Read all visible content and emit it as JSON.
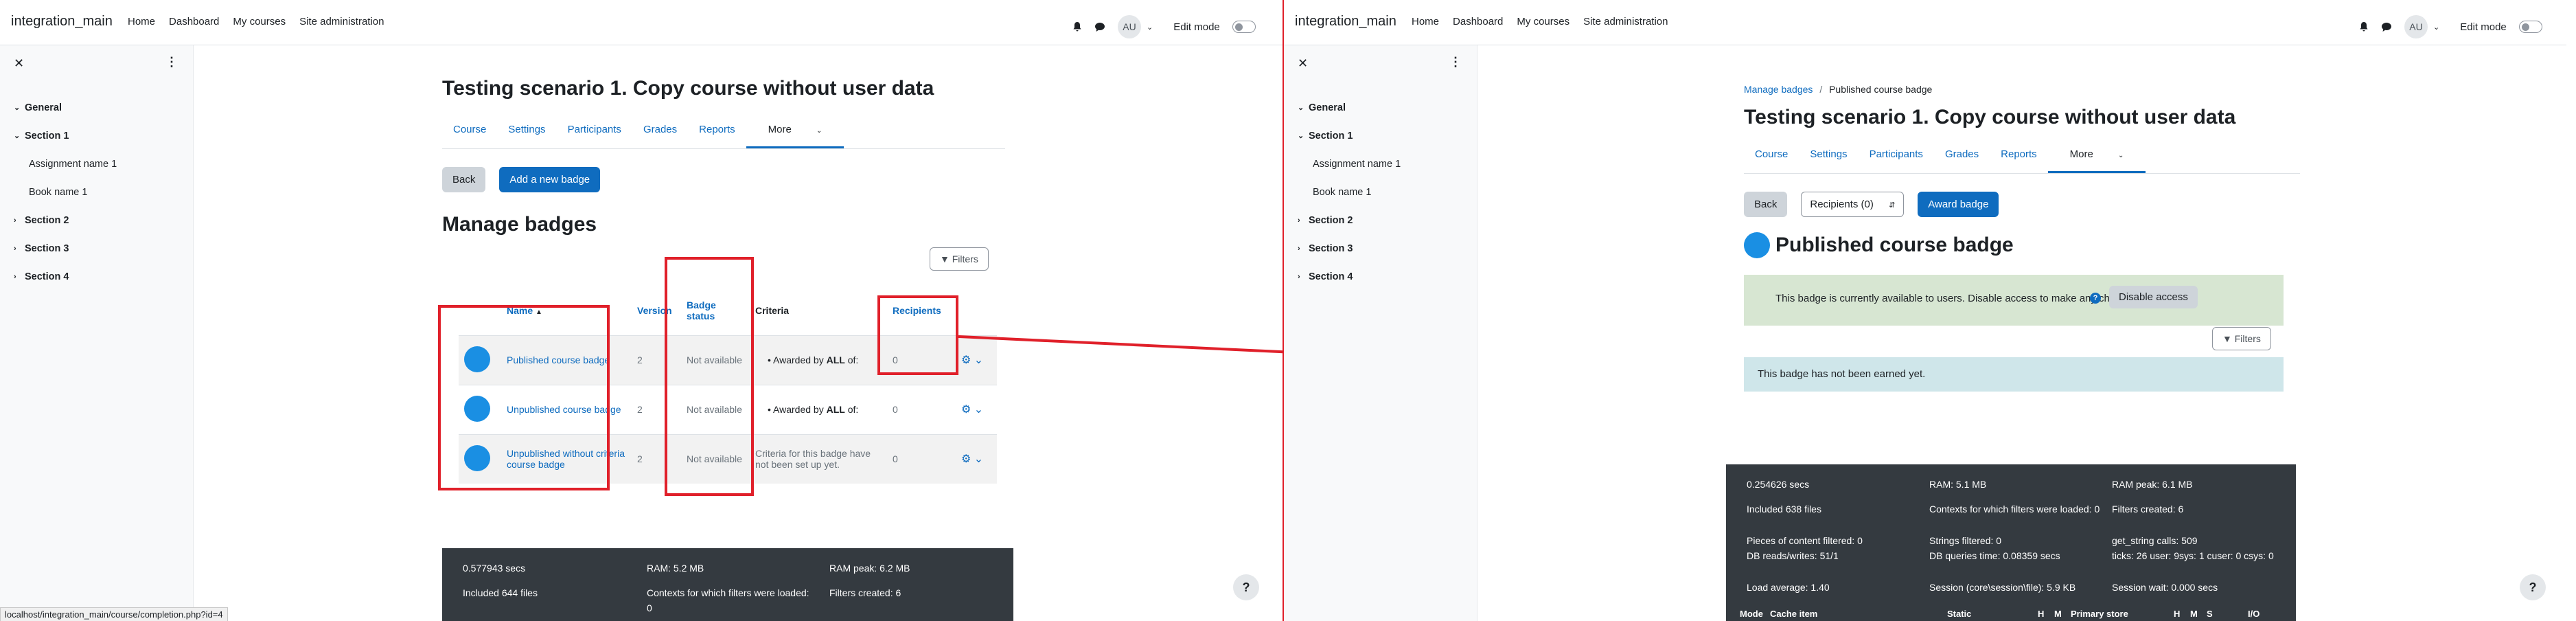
{
  "navbar": {
    "brand": "integration_main",
    "links": [
      "Home",
      "Dashboard",
      "My courses",
      "Site administration"
    ],
    "avatar": "AU",
    "edit_mode": "Edit mode"
  },
  "drawer": {
    "items": [
      {
        "label": "General",
        "type": "section"
      },
      {
        "label": "Section 1",
        "type": "section"
      },
      {
        "label": "Assignment name 1",
        "type": "activity"
      },
      {
        "label": "Book name 1",
        "type": "activity"
      },
      {
        "label": "Section 2",
        "type": "section"
      },
      {
        "label": "Section 3",
        "type": "section"
      },
      {
        "label": "Section 4",
        "type": "section"
      }
    ]
  },
  "course_title": "Testing scenario 1. Copy course without user data",
  "tabs": [
    "Course",
    "Settings",
    "Participants",
    "Grades",
    "Reports",
    "More"
  ],
  "left": {
    "back": "Back",
    "add_badge": "Add a new badge",
    "heading": "Manage badges",
    "filters": "Filters",
    "columns": {
      "name": "Name",
      "version": "Version",
      "status": "Badge status",
      "criteria": "Criteria",
      "recipients": "Recipients"
    },
    "rows": [
      {
        "name": "Published course badge",
        "version": "2",
        "status": "Not available",
        "criteria_prefix": "Awarded by",
        "criteria_bold": "ALL",
        "criteria_suffix": "of:",
        "recipients": "0"
      },
      {
        "name": "Unpublished course badge",
        "version": "2",
        "status": "Not available",
        "criteria_prefix": "Awarded by",
        "criteria_bold": "ALL",
        "criteria_suffix": "of:",
        "recipients": "0"
      },
      {
        "name": "Unpublished without criteria course badge",
        "version": "2",
        "status": "Not available",
        "criteria_text": "Criteria for this badge have not been set up yet.",
        "recipients": "0"
      }
    ],
    "footer": {
      "time": "0.577943 secs",
      "ram": "RAM: 5.2 MB",
      "ram_peak": "RAM peak: 6.2 MB",
      "included": "Included 644 files",
      "contexts": "Contexts for which filters were loaded: 0",
      "filters_created": "Filters created: 6"
    },
    "status_url": "localhost/integration_main/course/completion.php?id=4"
  },
  "right": {
    "breadcrumb": [
      "Manage badges",
      "Published course badge"
    ],
    "back": "Back",
    "recipients_select": "Recipients (0)",
    "award": "Award badge",
    "badge_title": "Published course badge",
    "available_msg": "This badge is currently available to users. Disable access to make any changes.",
    "disable_access": "Disable access",
    "filters": "Filters",
    "not_earned": "This badge has not been earned yet.",
    "footer": {
      "time": "0.254626 secs",
      "ram": "RAM: 5.1 MB",
      "ram_peak": "RAM peak: 6.1 MB",
      "included": "Included 638 files",
      "contexts": "Contexts for which filters were loaded: 0",
      "filters_created": "Filters created: 6",
      "pieces": "Pieces of content filtered: 0",
      "strings": "Strings filtered: 0",
      "get_string": "get_string calls: 509",
      "db_rw": "DB reads/writes: 51/1",
      "db_time": "DB queries time: 0.08359 secs",
      "ticks": "ticks: 26 user: 9sys: 1 cuser: 0 csys: 0",
      "load": "Load average: 1.40",
      "session": "Session (core\\session\\file): 5.9 KB",
      "session_wait": "Session wait: 0.000 secs",
      "table_headers": [
        "Mode",
        "Cache item",
        "Static",
        "H",
        "M",
        "Primary store",
        "H",
        "M",
        "S",
        "I/O"
      ]
    }
  }
}
